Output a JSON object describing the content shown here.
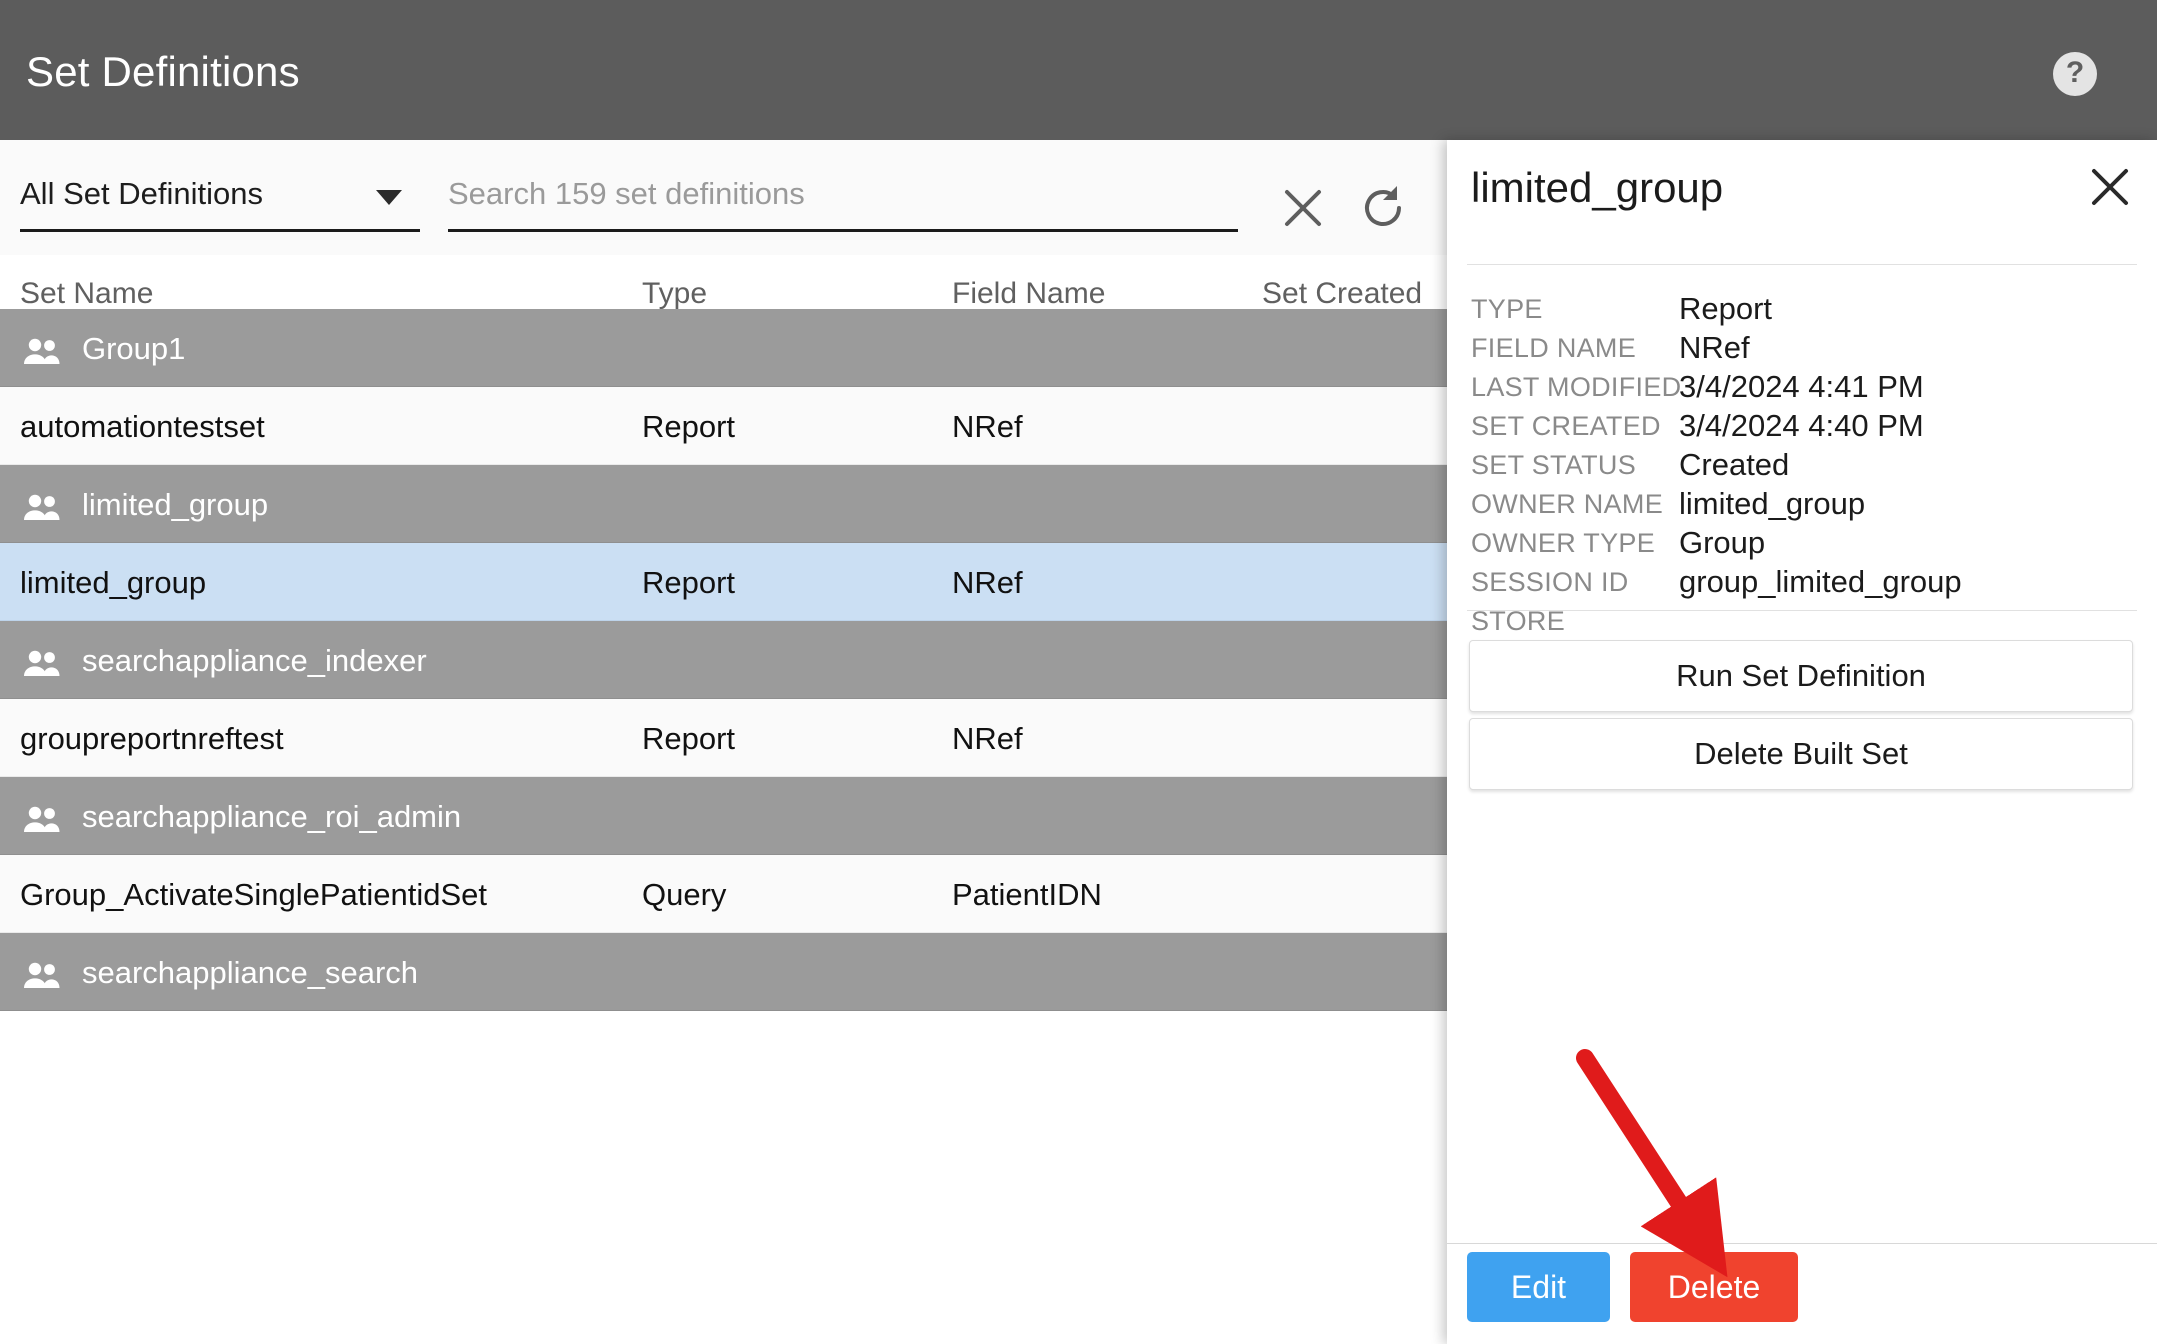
{
  "header": {
    "title": "Set Definitions",
    "help_icon": "question-mark-circle-icon"
  },
  "toolbar": {
    "filter_label": "All Set Definitions",
    "search_placeholder": "Search 159 set definitions",
    "clear_icon": "close-x-icon",
    "refresh_icon": "refresh-icon"
  },
  "table": {
    "columns": [
      "Set Name",
      "Type",
      "Field Name",
      "Set Created"
    ],
    "rows": [
      {
        "kind": "group",
        "name": "Group1",
        "type": "",
        "field": "",
        "created": ""
      },
      {
        "kind": "data",
        "name": "automationtestset",
        "type": "Report",
        "field": "NRef",
        "created": ""
      },
      {
        "kind": "group",
        "name": "limited_group",
        "type": "",
        "field": "",
        "created": ""
      },
      {
        "kind": "data",
        "name": "limited_group",
        "type": "Report",
        "field": "NRef",
        "created": "",
        "selected": true
      },
      {
        "kind": "group",
        "name": "searchappliance_indexer",
        "type": "",
        "field": "",
        "created": ""
      },
      {
        "kind": "data",
        "name": "groupreportnreftest",
        "type": "Report",
        "field": "NRef",
        "created": ""
      },
      {
        "kind": "group",
        "name": "searchappliance_roi_admin",
        "type": "",
        "field": "",
        "created": ""
      },
      {
        "kind": "data",
        "name": "Group_ActivateSinglePatientidSet",
        "type": "Query",
        "field": "PatientIDN",
        "created": ""
      },
      {
        "kind": "group",
        "name": "searchappliance_search",
        "type": "",
        "field": "",
        "created": ""
      }
    ]
  },
  "detail": {
    "title": "limited_group",
    "close_icon": "close-x-icon",
    "properties": [
      {
        "key": "TYPE",
        "value": "Report"
      },
      {
        "key": "FIELD NAME",
        "value": "NRef"
      },
      {
        "key": "LAST MODIFIED",
        "value": "3/4/2024 4:41 PM"
      },
      {
        "key": "SET CREATED",
        "value": "3/4/2024 4:40 PM"
      },
      {
        "key": "SET STATUS",
        "value": "Created"
      },
      {
        "key": "OWNER NAME",
        "value": "limited_group"
      },
      {
        "key": "OWNER TYPE",
        "value": "Group"
      },
      {
        "key": "SESSION ID",
        "value": "group_limited_group"
      },
      {
        "key": "STORE",
        "value": ""
      }
    ],
    "actions": {
      "run_label": "Run Set Definition",
      "delete_built_label": "Delete Built Set"
    },
    "footer": {
      "edit_label": "Edit",
      "delete_label": "Delete"
    }
  },
  "annotation": {
    "arrow_color": "#e01b1b",
    "target": "delete-button"
  },
  "colors": {
    "header_bar": "#5c5c5c",
    "group_row": "#9b9b9b",
    "data_row": "#fafafa",
    "selected_row": "#cbdff3",
    "edit_button": "#3fa2f0",
    "delete_button": "#f0432e"
  }
}
